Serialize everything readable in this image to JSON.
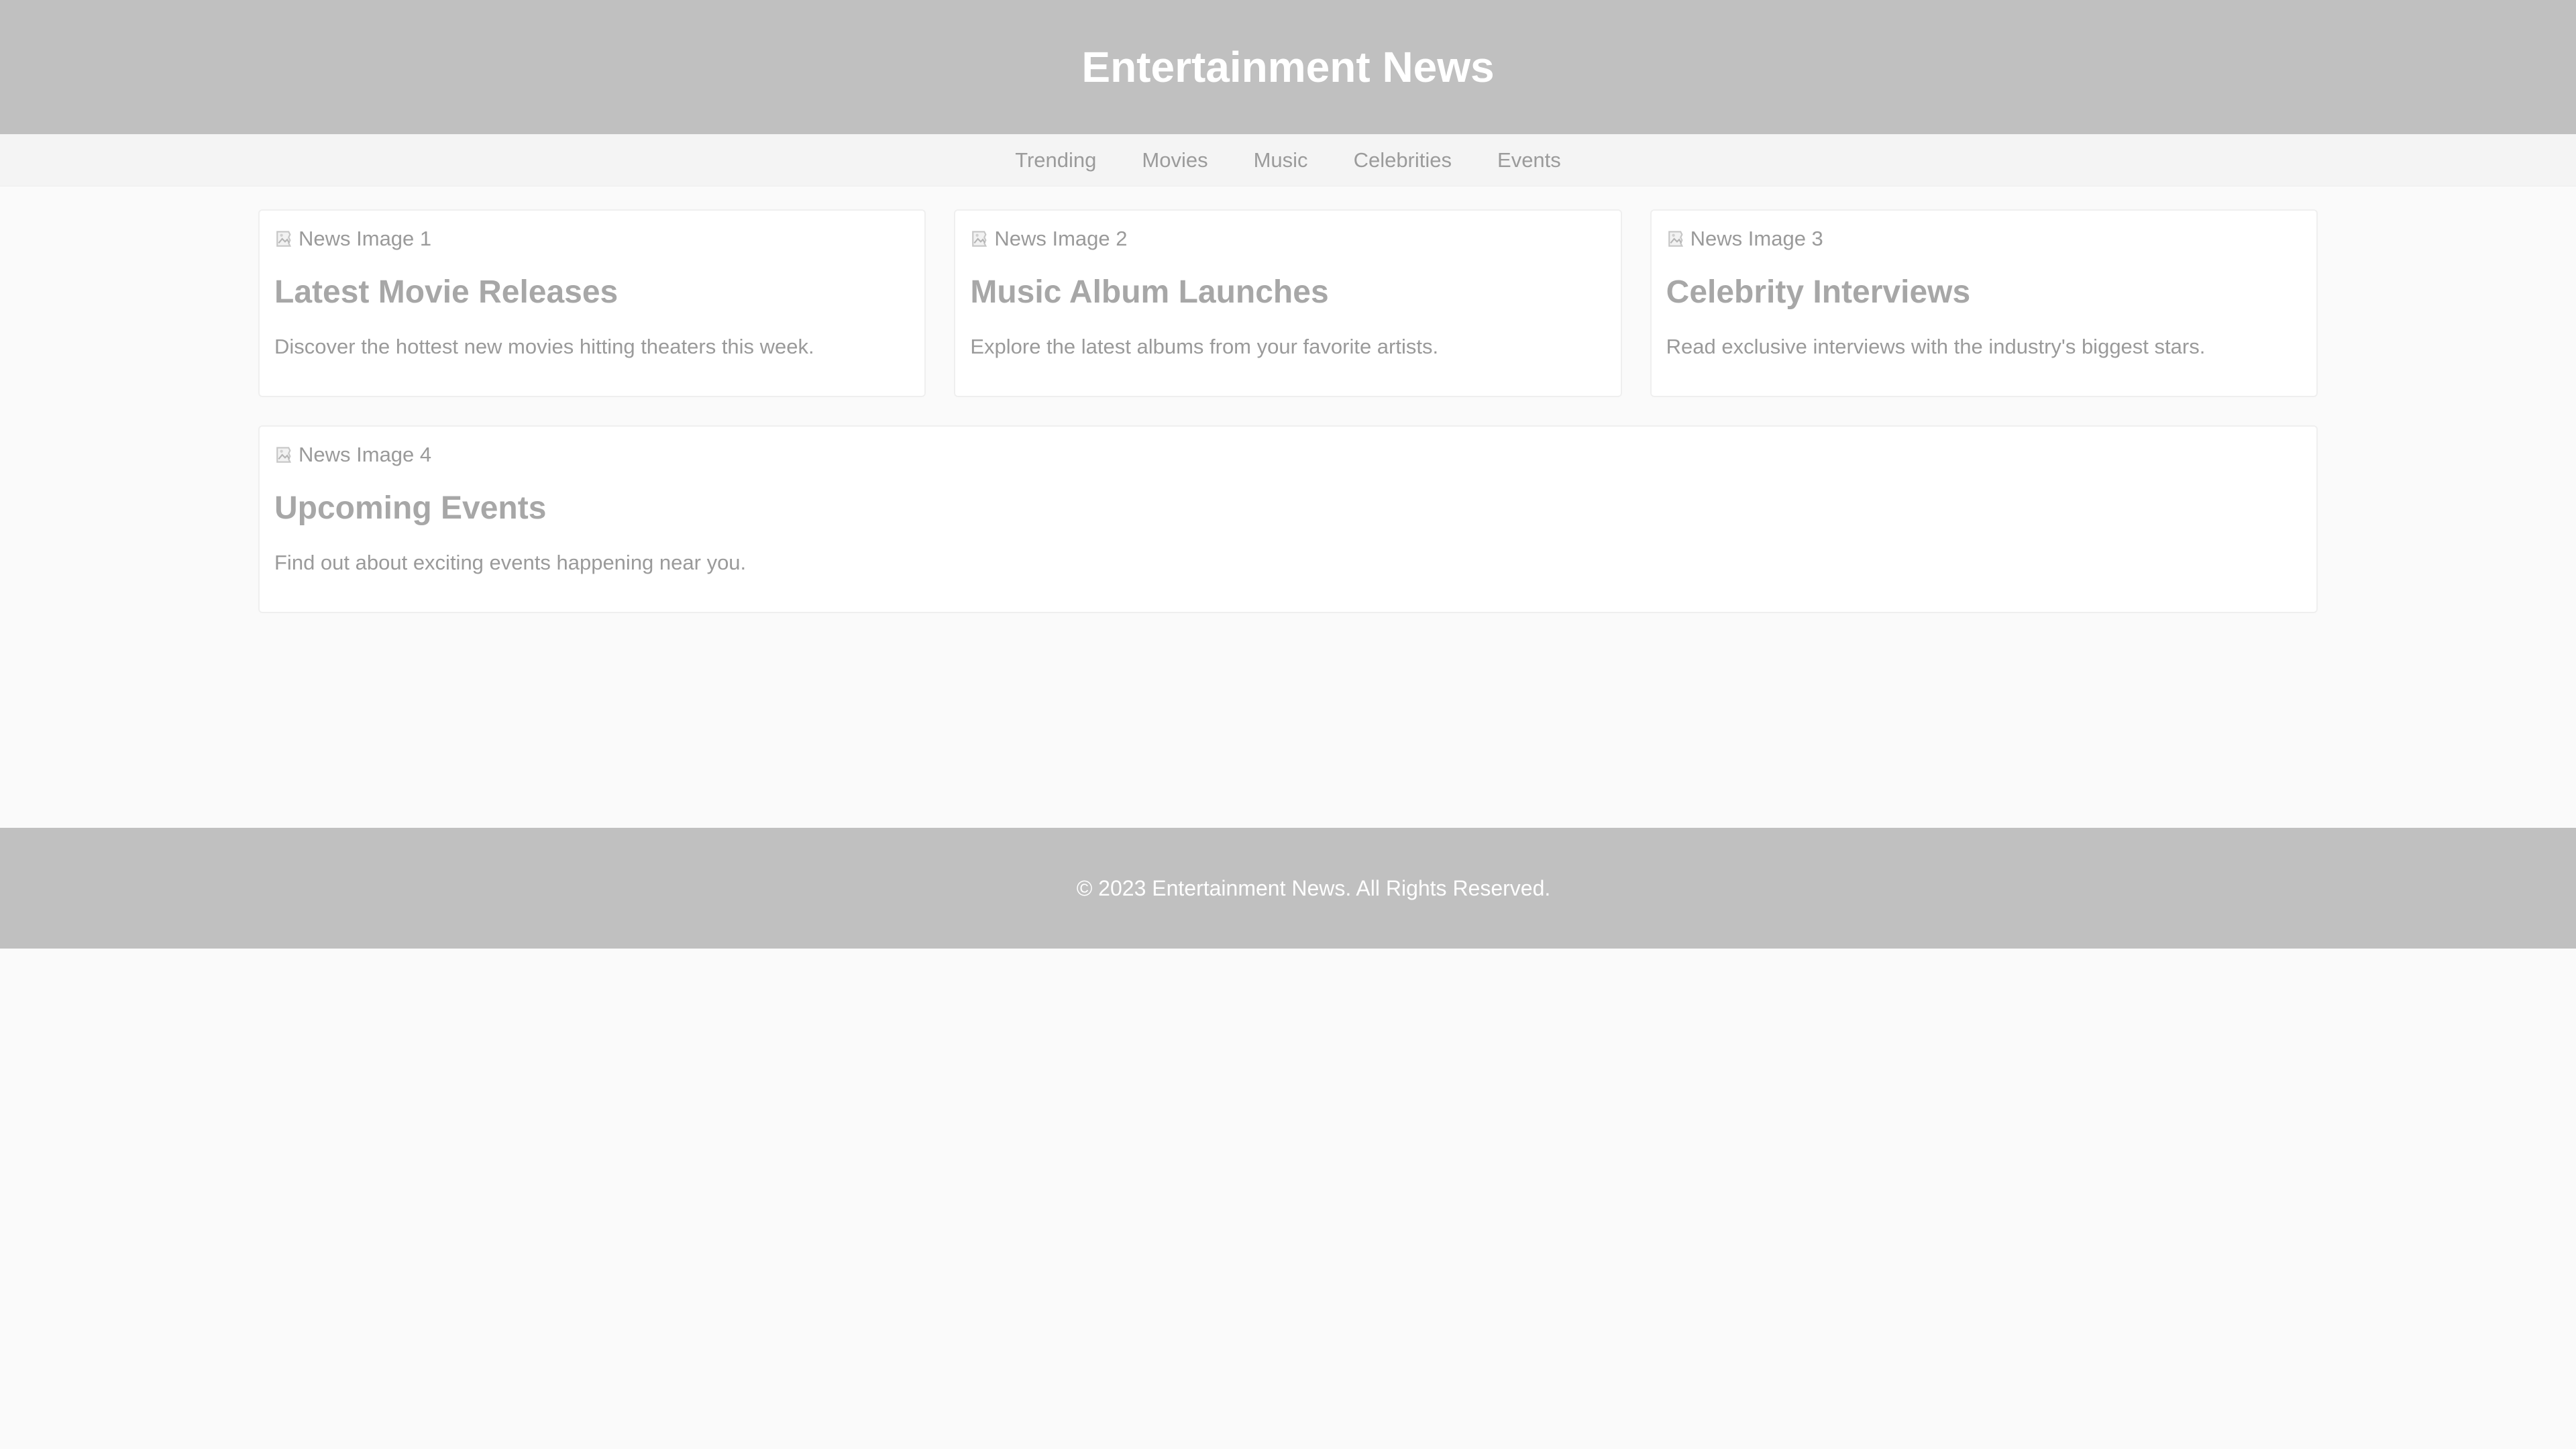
{
  "header": {
    "title": "Entertainment News"
  },
  "nav": {
    "items": [
      "Trending",
      "Movies",
      "Music",
      "Celebrities",
      "Events"
    ]
  },
  "articles": [
    {
      "image_alt": "News Image 1",
      "title": "Latest Movie Releases",
      "description": "Discover the hottest new movies hitting theaters this week."
    },
    {
      "image_alt": "News Image 2",
      "title": "Music Album Launches",
      "description": "Explore the latest albums from your favorite artists."
    },
    {
      "image_alt": "News Image 3",
      "title": "Celebrity Interviews",
      "description": "Read exclusive interviews with the industry's biggest stars."
    },
    {
      "image_alt": "News Image 4",
      "title": "Upcoming Events",
      "description": "Find out about exciting events happening near you."
    }
  ],
  "footer": {
    "text": "© 2023 Entertainment News. All Rights Reserved."
  },
  "colors": {
    "header_bg": "#c0c0c0",
    "page_bg": "#fafafa",
    "nav_bg": "#f4f4f4",
    "card_bg": "#ffffff"
  },
  "icons": {
    "image_placeholder": "broken-image-icon"
  }
}
